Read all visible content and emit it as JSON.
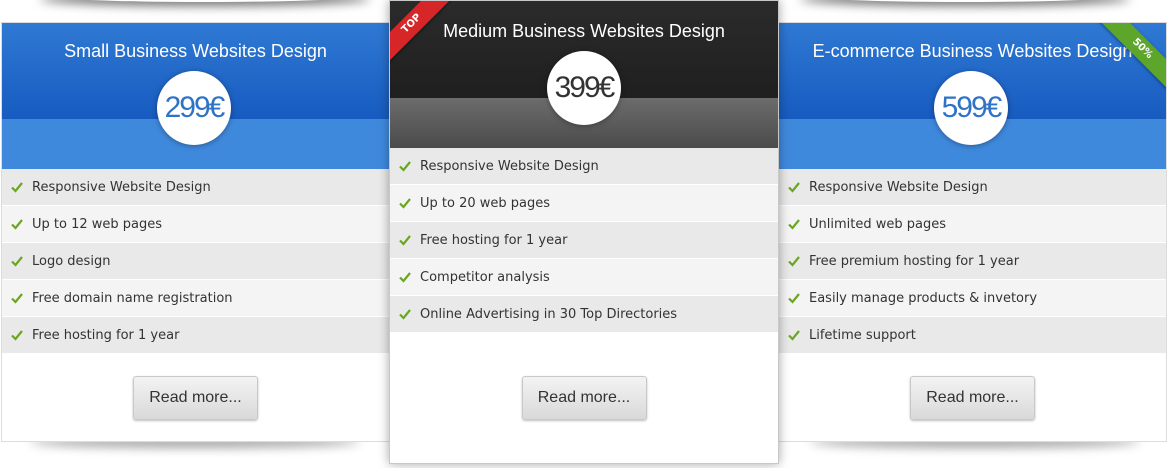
{
  "plans": [
    {
      "title": "Small Business Websites Design",
      "price": "299€",
      "features": [
        "Responsive Website Design",
        "Up to 12 web pages",
        "Logo design",
        "Free domain name registration",
        "Free hosting for 1 year"
      ],
      "button": "Read more..."
    },
    {
      "title": "Medium Business Websites Design",
      "price": "399€",
      "ribbon": "TOP",
      "features": [
        "Responsive Website Design",
        "Up to 20 web pages",
        "Free hosting for 1 year",
        "Competitor analysis",
        "Online Advertising in 30 Top Directories"
      ],
      "button": "Read more..."
    },
    {
      "title": "E-commerce Business Websites Design",
      "price": "599€",
      "ribbon": "50%",
      "features": [
        "Responsive Website Design",
        "Unlimited web pages",
        "Free premium hosting for 1 year",
        "Easily manage products & invetory",
        "Lifetime support"
      ],
      "button": "Read more..."
    }
  ],
  "colors": {
    "blue_header": "#1f65c8",
    "dark_header": "#262626",
    "check_green": "#6aa620",
    "ribbon_red": "#d62628",
    "ribbon_green": "#5ea62b"
  },
  "icons": {
    "feature": "check-icon"
  }
}
